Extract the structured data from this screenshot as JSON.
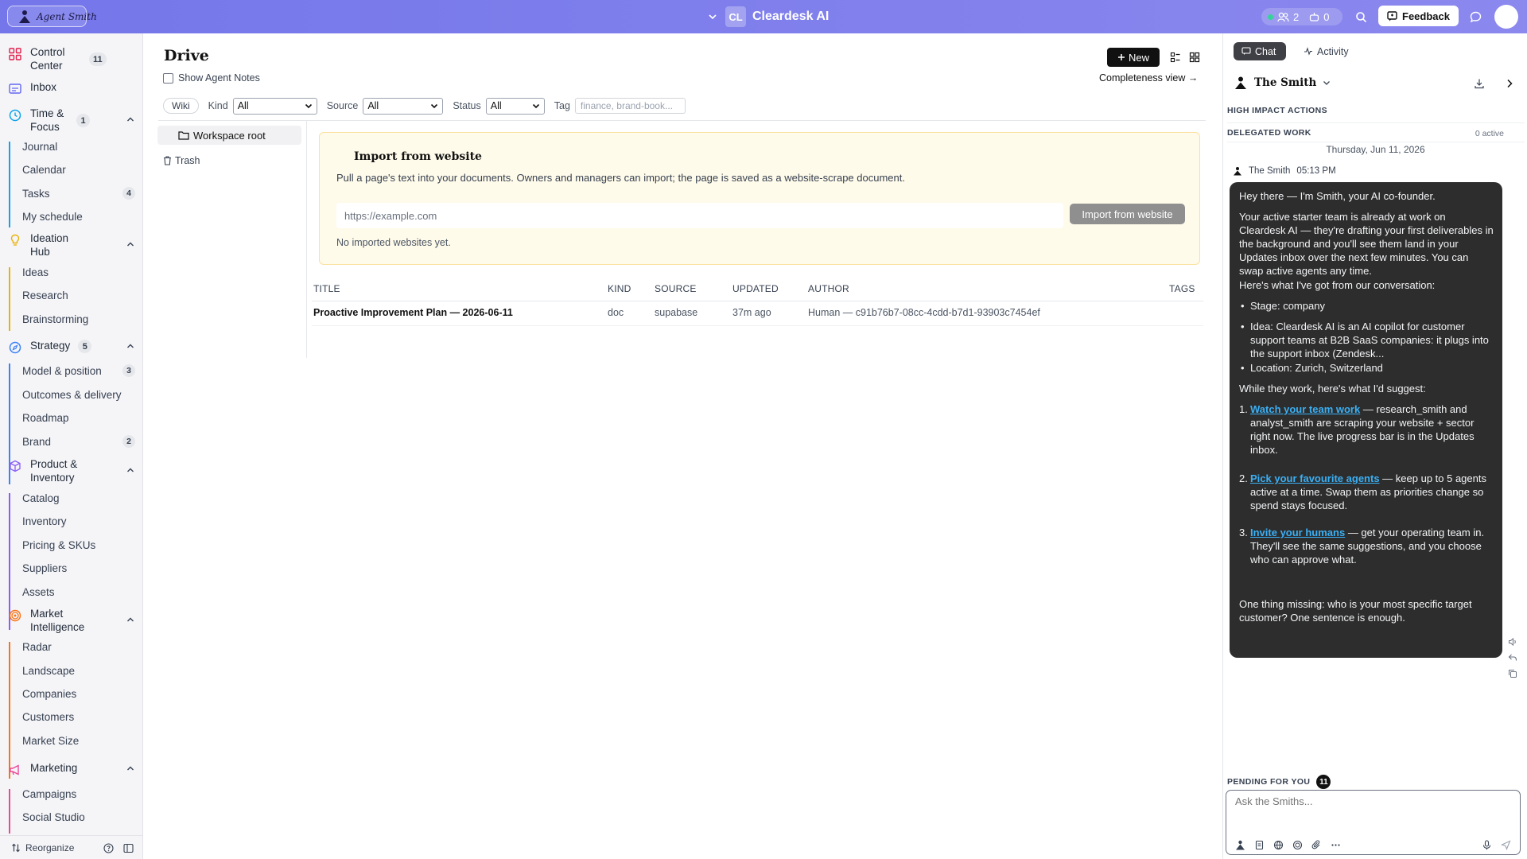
{
  "topbar": {
    "logo_text": "Agent Smith",
    "workspace_initials": "CL",
    "workspace_name": "Cleardesk AI",
    "people_count": "2",
    "bots_count": "0",
    "feedback_label": "Feedback"
  },
  "sidebar": {
    "sections": [
      {
        "label": "Control Center",
        "badge": "11"
      },
      {
        "label": "Inbox"
      },
      {
        "label": "Time & Focus",
        "badge": "1",
        "color": "#0ea5e9",
        "items": [
          {
            "label": "Journal"
          },
          {
            "label": "Calendar"
          },
          {
            "label": "Tasks",
            "badge": "4"
          },
          {
            "label": "My schedule"
          }
        ]
      },
      {
        "label": "Ideation Hub",
        "color": "#eab308",
        "items": [
          {
            "label": "Ideas"
          },
          {
            "label": "Research"
          },
          {
            "label": "Brainstorming"
          }
        ]
      },
      {
        "label": "Strategy",
        "badge": "5",
        "color": "#3b82f6",
        "items": [
          {
            "label": "Model & position",
            "badge": "3"
          },
          {
            "label": "Outcomes & delivery"
          },
          {
            "label": "Roadmap"
          },
          {
            "label": "Brand",
            "badge": "2"
          }
        ]
      },
      {
        "label": "Product & Inventory",
        "color": "#8b5cf6",
        "items": [
          {
            "label": "Catalog"
          },
          {
            "label": "Inventory"
          },
          {
            "label": "Pricing & SKUs"
          },
          {
            "label": "Suppliers"
          },
          {
            "label": "Assets"
          }
        ]
      },
      {
        "label": "Market Intelligence",
        "color": "#f97316",
        "items": [
          {
            "label": "Radar"
          },
          {
            "label": "Landscape"
          },
          {
            "label": "Companies"
          },
          {
            "label": "Customers"
          },
          {
            "label": "Market Size"
          }
        ]
      },
      {
        "label": "Marketing",
        "color": "#ec4899",
        "items": [
          {
            "label": "Campaigns"
          },
          {
            "label": "Social Studio"
          }
        ]
      }
    ],
    "reorganize_label": "Reorganize"
  },
  "drive": {
    "title": "Drive",
    "show_notes_label": "Show Agent Notes",
    "new_label": "New",
    "completeness_label": "Completeness view →",
    "filters": {
      "wiki_label": "Wiki",
      "kind_label": "Kind",
      "kind_value": "All",
      "source_label": "Source",
      "source_value": "All",
      "status_label": "Status",
      "status_value": "All",
      "tag_label": "Tag",
      "tag_placeholder": "finance, brand-book..."
    },
    "tree": {
      "root": "Workspace root",
      "trash": "Trash"
    },
    "import": {
      "title": "Import from website",
      "description": "Pull a page's text into your documents. Owners and managers can import; the page is saved as a website-scrape document.",
      "url_placeholder": "https://example.com",
      "button_label": "Import from website",
      "empty_text": "No imported websites yet."
    },
    "table": {
      "columns": [
        "TITLE",
        "KIND",
        "SOURCE",
        "UPDATED",
        "AUTHOR",
        "TAGS"
      ],
      "rows": [
        [
          "Proactive Improvement Plan — 2026-06-11",
          "doc",
          "supabase",
          "37m ago",
          "Human — c91b76b7-08cc-4cdd-b7d1-93903c7454ef",
          ""
        ]
      ]
    }
  },
  "panel": {
    "tab_chat": "Chat",
    "tab_activity": "Activity",
    "agent_name": "The Smith",
    "high_impact_label": "HIGH IMPACT ACTIONS",
    "delegated_label": "DELEGATED WORK",
    "delegated_count": "0 active",
    "date": "Thursday, Jun 11, 2026",
    "message": {
      "author": "The Smith",
      "time": "05:13 PM",
      "greeting": "Hey there — I'm Smith, your AI co-founder.",
      "intro": "Your active starter team is already at work on Cleardesk AI — they're drafting your first deliverables in the background and you'll see them land in your Updates inbox over the next few minutes. You can swap active agents any time.",
      "got_label": "Here's what I've got from our conversation:",
      "bullets": [
        "Stage: company",
        "Idea: Cleardesk AI is an AI copilot for customer support teams at B2B SaaS companies: it plugs into the support inbox (Zendesk...",
        "Location: Zurich, Switzerland"
      ],
      "suggest_label": "While they work, here's what I'd suggest:",
      "steps": [
        {
          "link": "Watch your team work",
          "text": " — research_smith and analyst_smith are scraping your website + sector right now. The live progress bar is in the Updates inbox."
        },
        {
          "link": "Pick your favourite agents",
          "text": " — keep up to 5 agents active at a time. Swap them as priorities change so spend stays focused."
        },
        {
          "link": "Invite your humans",
          "text": " — get your operating team in. They'll see the same suggestions, and you choose who can approve what."
        }
      ],
      "closing": "One thing missing: who is your most specific target customer? One sentence is enough."
    },
    "pending_label": "PENDING FOR YOU",
    "pending_count": "11",
    "composer_placeholder": "Ask the Smiths..."
  }
}
